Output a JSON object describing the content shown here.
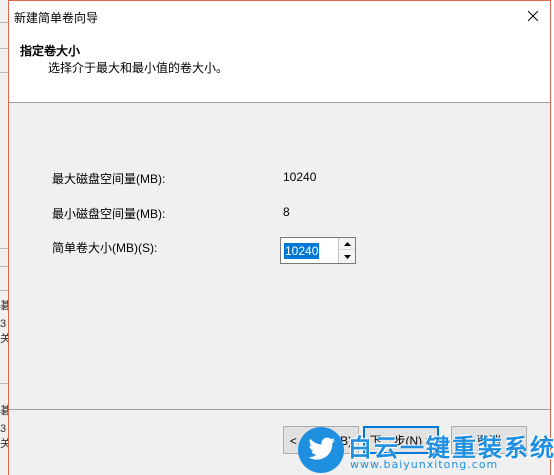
{
  "window": {
    "title": "新建简单卷向导"
  },
  "header": {
    "title": "指定卷大小",
    "subtitle": "选择介于最大和最小值的卷大小。"
  },
  "fields": {
    "max_label": "最大磁盘空间量(MB):",
    "max_value": "10240",
    "min_label": "最小磁盘空间量(MB):",
    "min_value": "8",
    "size_label": "简单卷大小(MB)(S):",
    "size_value": "10240"
  },
  "buttons": {
    "back": "< 上一步(B)",
    "next": "下一步(N) >",
    "cancel": "取消"
  },
  "background_window": {
    "fragments": [
      "碁",
      "3",
      "关",
      "碁",
      "3",
      "关"
    ]
  },
  "watermark": {
    "brand": "白云一键重装系统",
    "url": "www.baiyunxitong.com"
  },
  "colors": {
    "accent": "#0078d7",
    "border_active": "#e0664f",
    "watermark": "#1f8fe0"
  }
}
